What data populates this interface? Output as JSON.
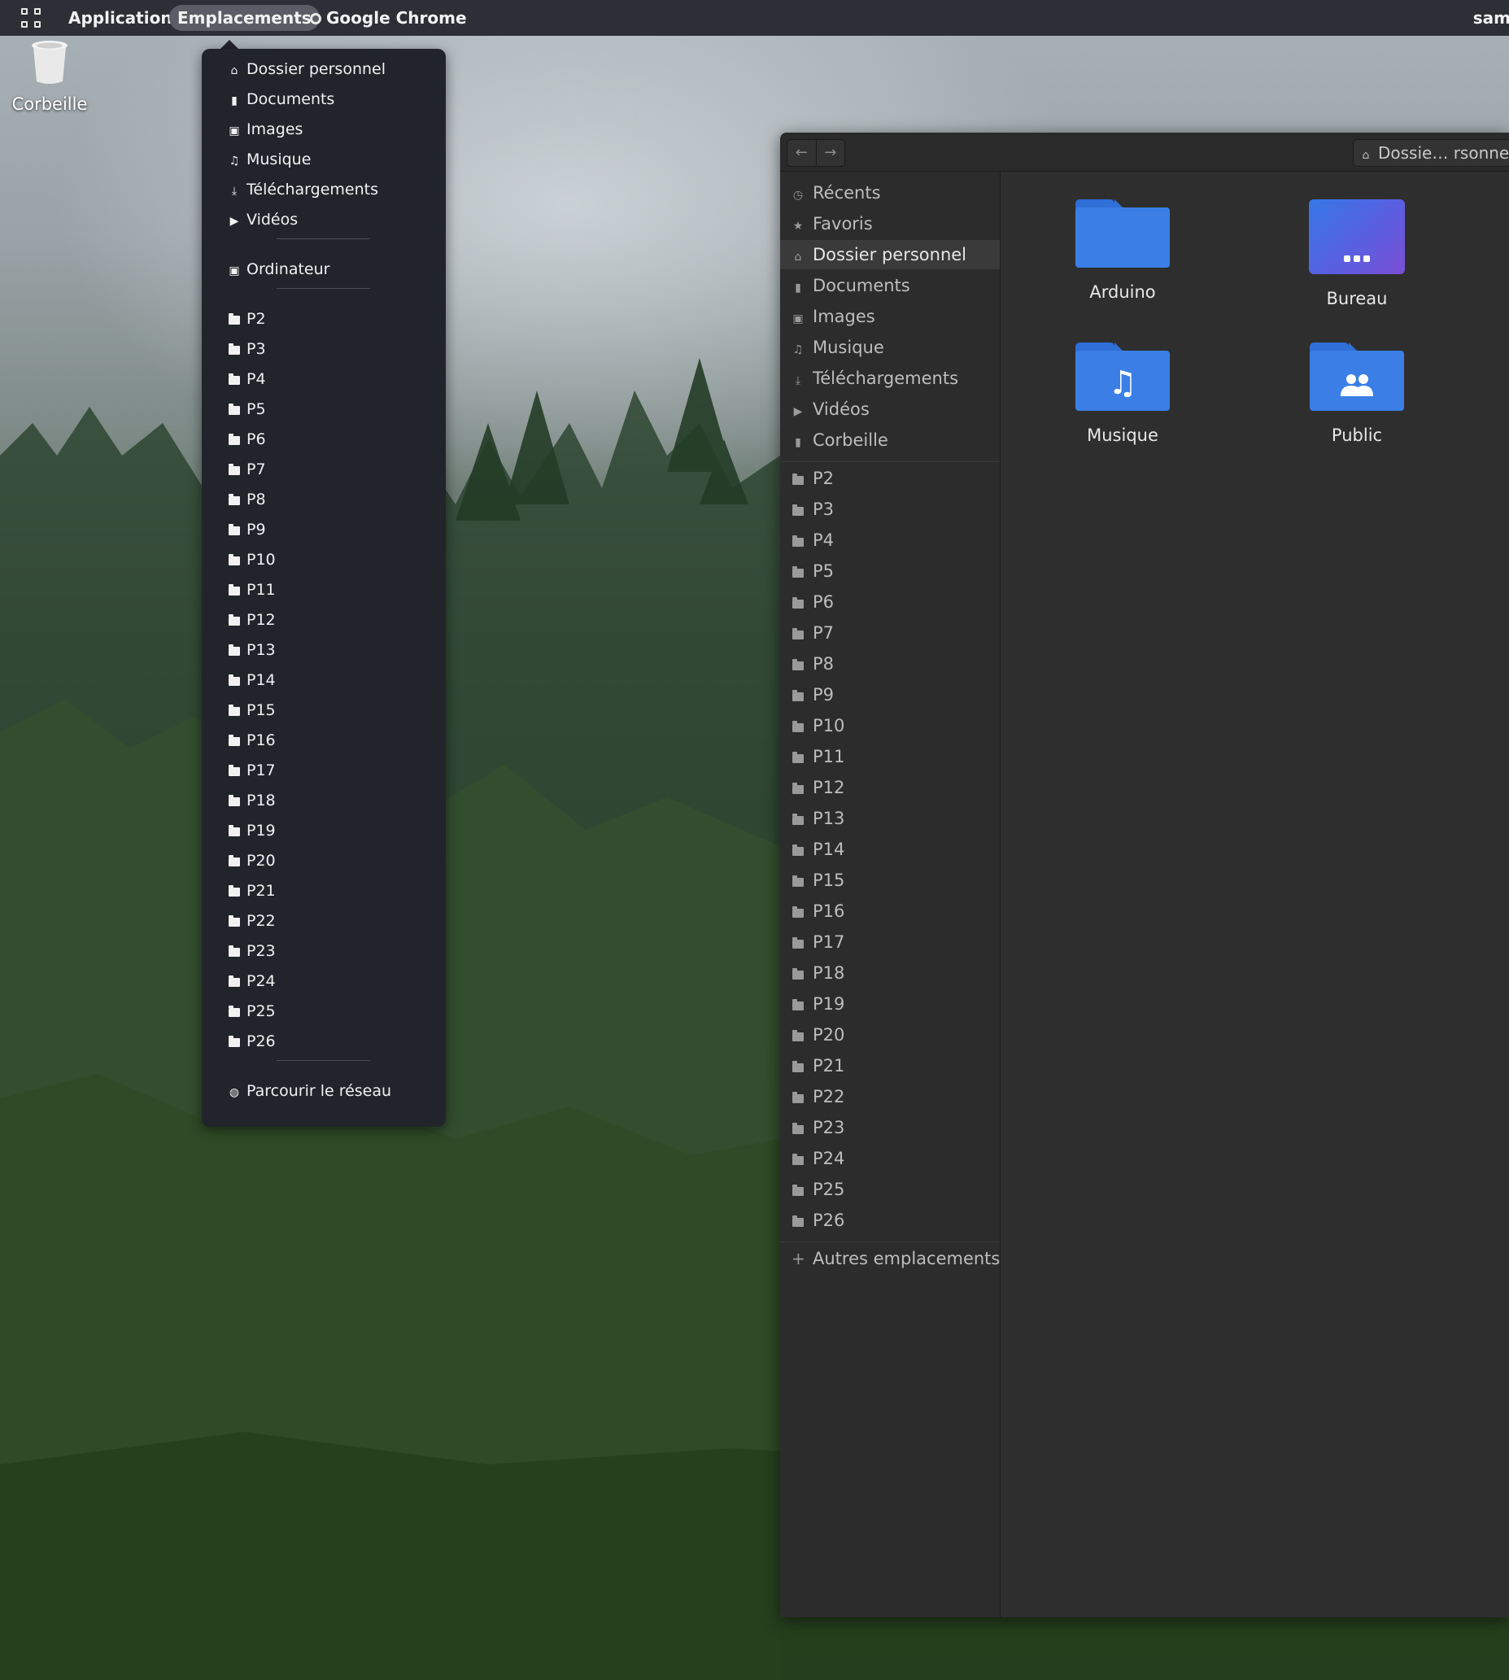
{
  "topbar": {
    "applications_label": "Applications",
    "places_label": "Emplacements",
    "app_label": "Google Chrome",
    "user_label": "sam"
  },
  "desktop": {
    "trash_label": "Corbeille"
  },
  "places_menu": {
    "standard": [
      {
        "label": "Dossier personnel",
        "icon": "home-icon"
      },
      {
        "label": "Documents",
        "icon": "document-icon"
      },
      {
        "label": "Images",
        "icon": "image-icon"
      },
      {
        "label": "Musique",
        "icon": "music-icon"
      },
      {
        "label": "Téléchargements",
        "icon": "download-icon"
      },
      {
        "label": "Vidéos",
        "icon": "video-icon"
      }
    ],
    "computer": {
      "label": "Ordinateur",
      "icon": "drive-icon"
    },
    "bookmarks": [
      "P2",
      "P3",
      "P4",
      "P5",
      "P6",
      "P7",
      "P8",
      "P9",
      "P10",
      "P11",
      "P12",
      "P13",
      "P14",
      "P15",
      "P16",
      "P17",
      "P18",
      "P19",
      "P20",
      "P21",
      "P22",
      "P23",
      "P24",
      "P25",
      "P26"
    ],
    "network": {
      "label": "Parcourir le réseau",
      "icon": "network-icon"
    }
  },
  "file_manager": {
    "back_icon": "back-arrow-icon",
    "forward_icon": "forward-arrow-icon",
    "path_label": "Dossie… rsonne",
    "sidebar": {
      "places": [
        {
          "label": "Récents",
          "icon": "clock-icon"
        },
        {
          "label": "Favoris",
          "icon": "star-icon"
        },
        {
          "label": "Dossier personnel",
          "icon": "home-icon",
          "selected": true
        },
        {
          "label": "Documents",
          "icon": "document-icon"
        },
        {
          "label": "Images",
          "icon": "image-icon"
        },
        {
          "label": "Musique",
          "icon": "music-icon"
        },
        {
          "label": "Téléchargements",
          "icon": "download-icon"
        },
        {
          "label": "Vidéos",
          "icon": "video-icon"
        },
        {
          "label": "Corbeille",
          "icon": "trash-icon"
        }
      ],
      "bookmarks": [
        "P2",
        "P3",
        "P4",
        "P5",
        "P6",
        "P7",
        "P8",
        "P9",
        "P10",
        "P11",
        "P12",
        "P13",
        "P14",
        "P15",
        "P16",
        "P17",
        "P18",
        "P19",
        "P20",
        "P21",
        "P22",
        "P23",
        "P24",
        "P25",
        "P26"
      ],
      "other_locations_label": "Autres emplacements"
    },
    "files": [
      {
        "name": "Arduino",
        "icon": "folder-icon"
      },
      {
        "name": "Bureau",
        "icon": "desktop-folder-icon"
      },
      {
        "name": "Musique",
        "icon": "music-folder-icon"
      },
      {
        "name": "Public",
        "icon": "public-folder-icon"
      }
    ]
  },
  "colors": {
    "topbar_bg": "#2d2f36",
    "menu_bg": "#22242b",
    "window_bg": "#2e2e2e",
    "folder_blue": "#3b7fe6"
  }
}
